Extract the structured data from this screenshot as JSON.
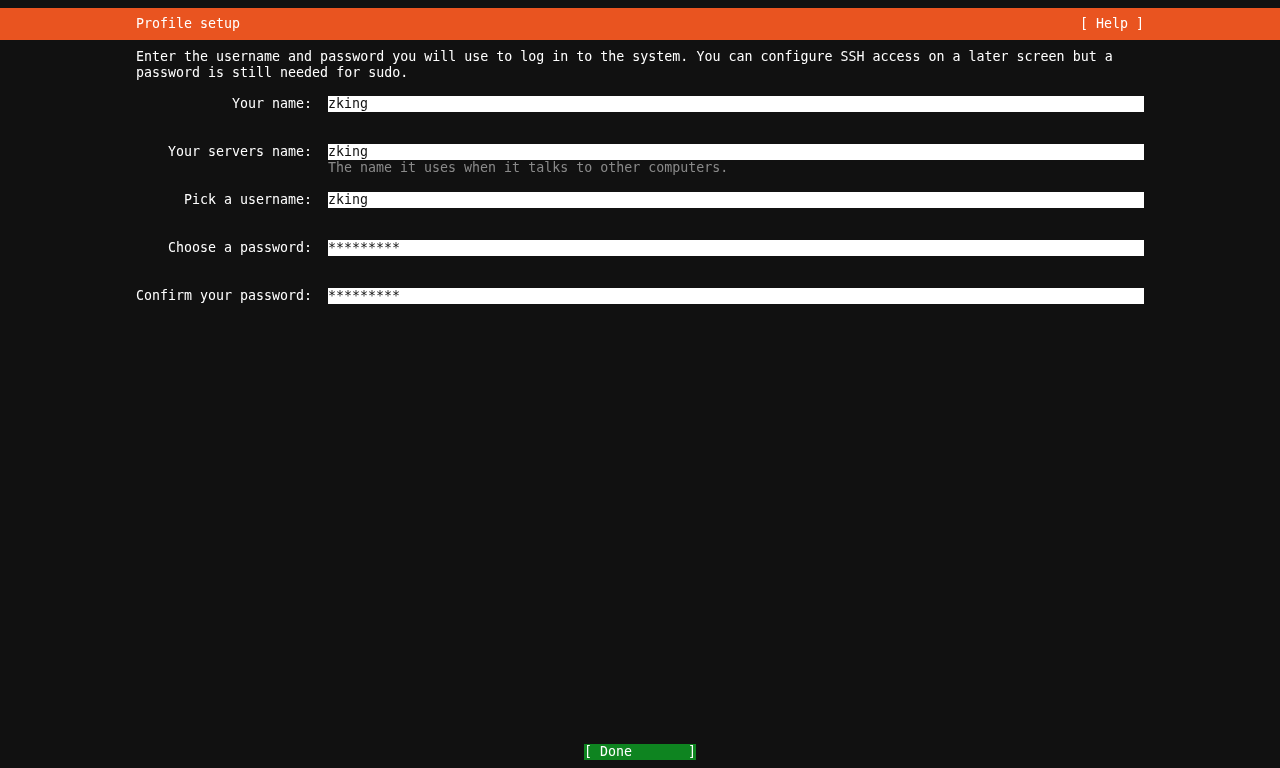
{
  "header": {
    "title": "Profile setup",
    "help": "[ Help ]"
  },
  "description": "Enter the username and password you will use to log in to the system. You can configure SSH access on a later screen but a password is still needed for sudo.",
  "fields": [
    {
      "label": "Your name:",
      "value": "zking"
    },
    {
      "label": "Your servers name:",
      "value": "zking",
      "hint": "The name it uses when it talks to other computers."
    },
    {
      "label": "Pick a username:",
      "value": "zking"
    },
    {
      "label": "Choose a password:",
      "value": "*********"
    },
    {
      "label": "Confirm your password:",
      "value": "*********"
    }
  ],
  "done_button": {
    "label": "[ Done       ]",
    "focused": true
  }
}
